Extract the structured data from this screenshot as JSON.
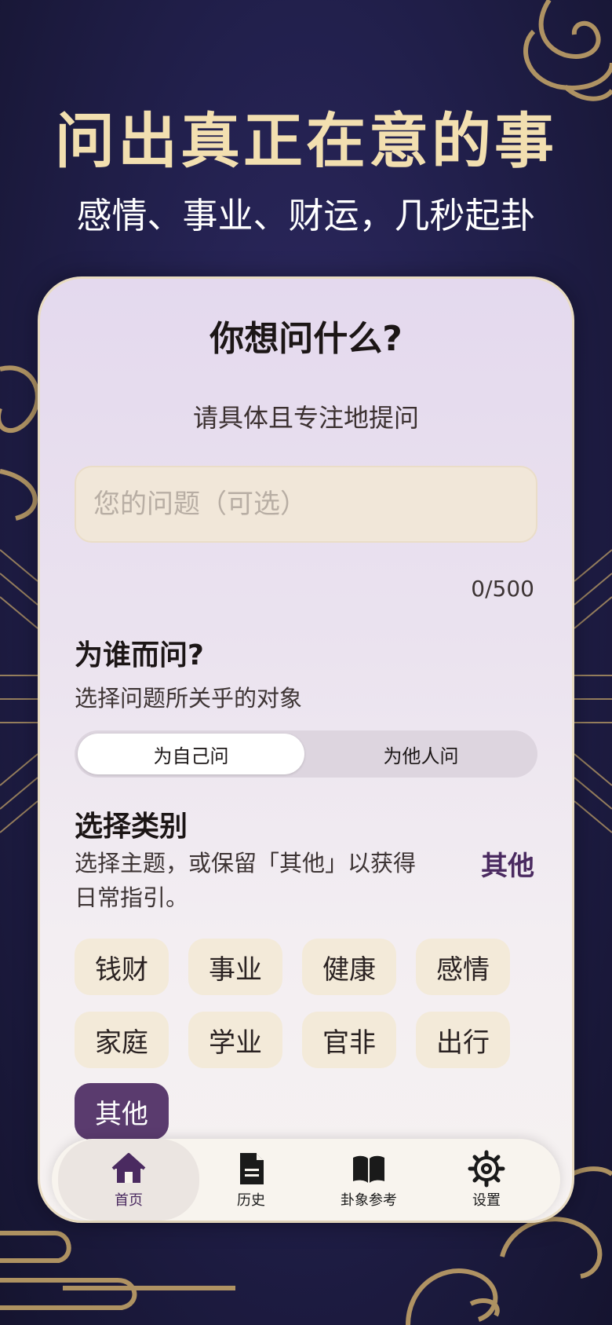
{
  "hero": {
    "title": "问出真正在意的事",
    "subtitle": "感情、事业、财运，几秒起卦"
  },
  "form": {
    "title": "你想问什么?",
    "subtitle": "请具体且专注地提问",
    "question_placeholder": "您的问题（可选）",
    "char_count": "0/500"
  },
  "target": {
    "title": "为谁而问?",
    "description": "选择问题所关乎的对象",
    "options": [
      "为自己问",
      "为他人问"
    ],
    "selected": "为自己问"
  },
  "category": {
    "title": "选择类别",
    "description_line1": "选择主题，或保留「其他」以获得",
    "description_line2": "日常指引。",
    "current": "其他",
    "chips": [
      "钱财",
      "事业",
      "健康",
      "感情",
      "家庭",
      "学业",
      "官非",
      "出行",
      "其他"
    ],
    "selected": "其他"
  },
  "nav": {
    "items": [
      {
        "label": "首页",
        "icon": "home-icon"
      },
      {
        "label": "历史",
        "icon": "document-icon"
      },
      {
        "label": "卦象参考",
        "icon": "book-icon"
      },
      {
        "label": "设置",
        "icon": "gear-icon"
      }
    ],
    "active": "首页"
  },
  "colors": {
    "background": "#22204d",
    "gold": "#c9a86a",
    "accent_purple": "#5a3b6e",
    "chip_bg": "#f3ead9"
  }
}
